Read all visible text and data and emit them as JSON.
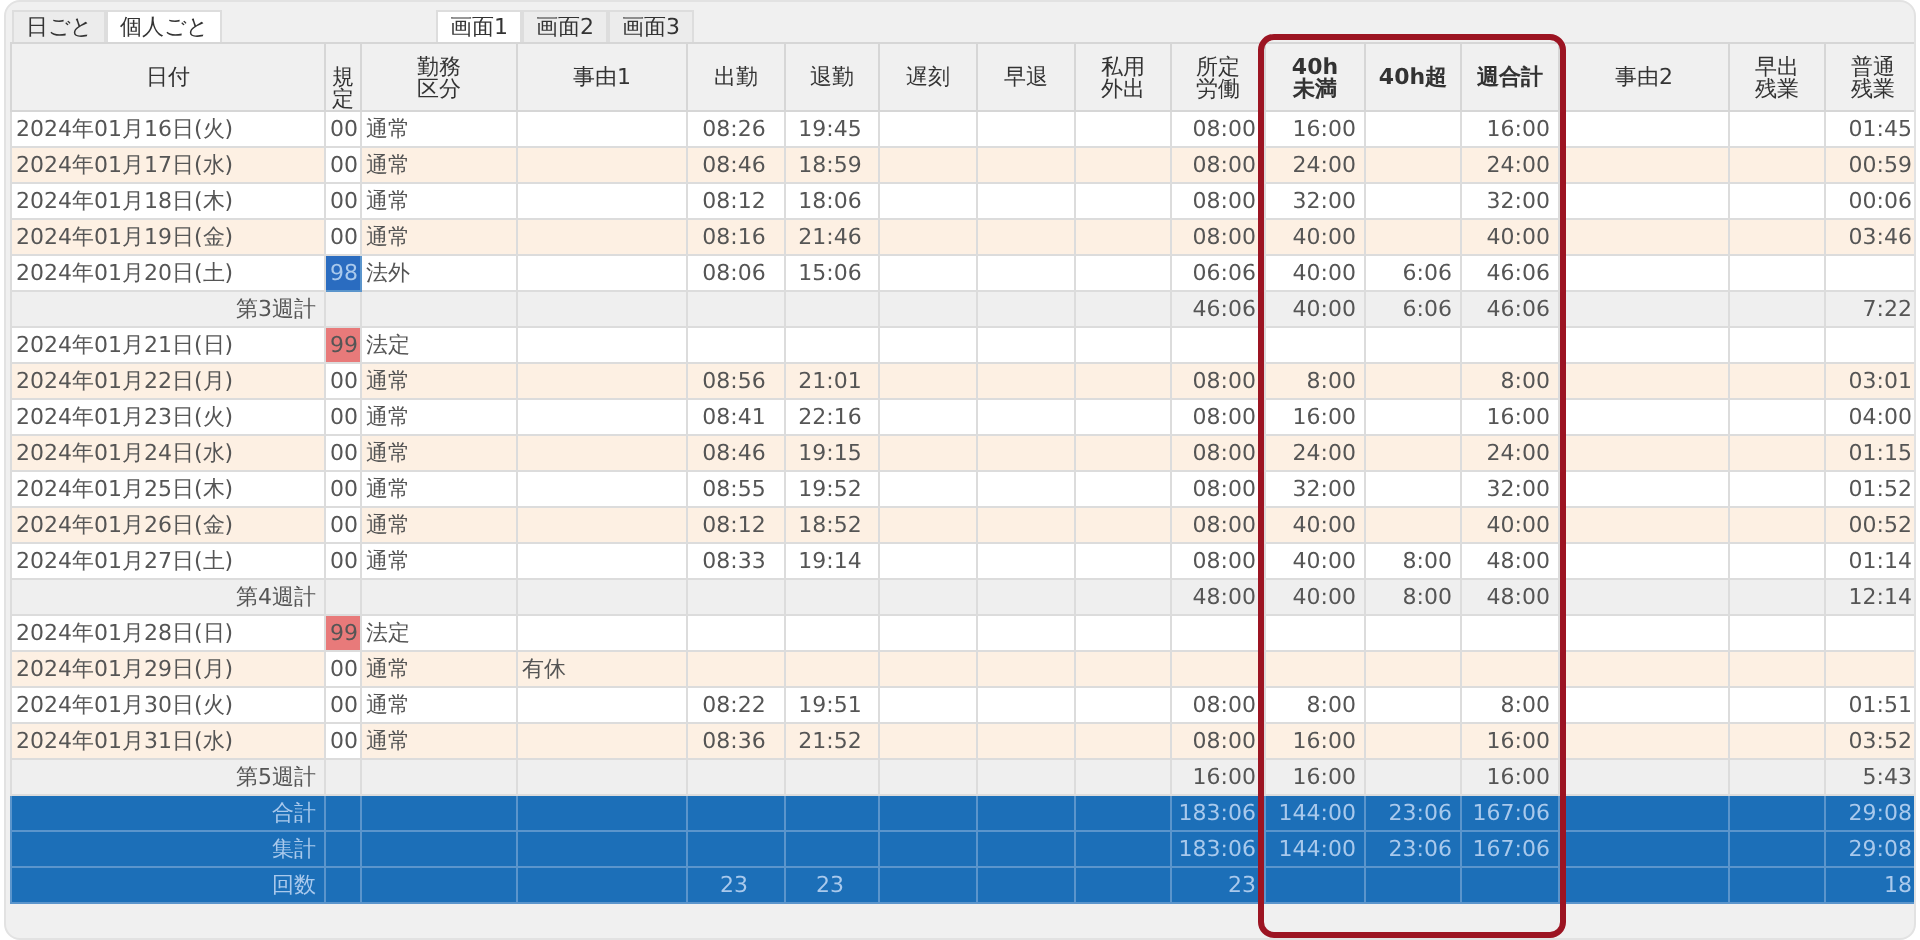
{
  "view_tabs": [
    {
      "label": "日ごと",
      "selected": false
    },
    {
      "label": "個人ごと",
      "selected": true
    }
  ],
  "screen_tabs": [
    {
      "label": "画面1",
      "selected": true
    },
    {
      "label": "画面2",
      "selected": false
    },
    {
      "label": "画面3",
      "selected": false
    }
  ],
  "columns": [
    {
      "label": "日付",
      "wrap": false,
      "highlight": false
    },
    {
      "label": "規定",
      "wrap": true,
      "highlight": false
    },
    {
      "label": "勤務区分",
      "wrap": true,
      "highlight": false
    },
    {
      "label": "事由1",
      "wrap": false,
      "highlight": false
    },
    {
      "label": "出勤",
      "wrap": false,
      "highlight": false
    },
    {
      "label": "退勤",
      "wrap": false,
      "highlight": false
    },
    {
      "label": "遅刻",
      "wrap": false,
      "highlight": false
    },
    {
      "label": "早退",
      "wrap": false,
      "highlight": false
    },
    {
      "label": "私用外出",
      "wrap": true,
      "highlight": false
    },
    {
      "label": "所定労働",
      "wrap": true,
      "highlight": false
    },
    {
      "label": "40h未満",
      "wrap": true,
      "highlight": true
    },
    {
      "label": "40h超",
      "wrap": false,
      "highlight": true
    },
    {
      "label": "週合計",
      "wrap": false,
      "highlight": true
    },
    {
      "label": "事由2",
      "wrap": false,
      "highlight": false
    },
    {
      "label": "早出残業",
      "wrap": true,
      "highlight": false
    },
    {
      "label": "普通残業",
      "wrap": true,
      "highlight": false
    }
  ],
  "rows": [
    {
      "kind": "day",
      "shaded": false,
      "date": "2024年01月16日(火)",
      "code": {
        "text": "00",
        "color": "#ffffff"
      },
      "category": "通常",
      "clock_in": "08:26",
      "clock_out": "19:45",
      "scheduled": "08:00",
      "under_40h": "16:00",
      "week_total": "16:00",
      "normal_overtime": "01:45"
    },
    {
      "kind": "day",
      "shaded": true,
      "date": "2024年01月17日(水)",
      "code": {
        "text": "00",
        "color": "#ffffff"
      },
      "category": "通常",
      "clock_in": "08:46",
      "clock_out": "18:59",
      "scheduled": "08:00",
      "under_40h": "24:00",
      "week_total": "24:00",
      "normal_overtime": "00:59"
    },
    {
      "kind": "day",
      "shaded": false,
      "date": "2024年01月18日(木)",
      "code": {
        "text": "00",
        "color": "#ffffff"
      },
      "category": "通常",
      "clock_in": "08:12",
      "clock_out": "18:06",
      "scheduled": "08:00",
      "under_40h": "32:00",
      "week_total": "32:00",
      "normal_overtime": "00:06"
    },
    {
      "kind": "day",
      "shaded": true,
      "date": "2024年01月19日(金)",
      "code": {
        "text": "00",
        "color": "#ffffff"
      },
      "category": "通常",
      "clock_in": "08:16",
      "clock_out": "21:46",
      "scheduled": "08:00",
      "under_40h": "40:00",
      "week_total": "40:00",
      "normal_overtime": "03:46"
    },
    {
      "kind": "day",
      "shaded": false,
      "date": "2024年01月20日(土)",
      "code": {
        "text": "98",
        "color": "#2a6cc0"
      },
      "category": "法外",
      "clock_in": "08:06",
      "clock_out": "15:06",
      "scheduled": "06:06",
      "under_40h": "40:00",
      "over_40h": "6:06",
      "week_total": "46:06"
    },
    {
      "kind": "week",
      "date": "第3週計",
      "scheduled": "46:06",
      "under_40h": "40:00",
      "over_40h": "6:06",
      "week_total": "46:06",
      "normal_overtime": "7:22"
    },
    {
      "kind": "day",
      "shaded": false,
      "date": "2024年01月21日(日)",
      "code": {
        "text": "99",
        "color": "#e87a7a"
      },
      "category": "法定"
    },
    {
      "kind": "day",
      "shaded": true,
      "date": "2024年01月22日(月)",
      "code": {
        "text": "00",
        "color": "#ffffff"
      },
      "category": "通常",
      "clock_in": "08:56",
      "clock_out": "21:01",
      "scheduled": "08:00",
      "under_40h": "8:00",
      "week_total": "8:00",
      "normal_overtime": "03:01"
    },
    {
      "kind": "day",
      "shaded": false,
      "date": "2024年01月23日(火)",
      "code": {
        "text": "00",
        "color": "#ffffff"
      },
      "category": "通常",
      "clock_in": "08:41",
      "clock_out": "22:16",
      "scheduled": "08:00",
      "under_40h": "16:00",
      "week_total": "16:00",
      "normal_overtime": "04:00"
    },
    {
      "kind": "day",
      "shaded": true,
      "date": "2024年01月24日(水)",
      "code": {
        "text": "00",
        "color": "#ffffff"
      },
      "category": "通常",
      "clock_in": "08:46",
      "clock_out": "19:15",
      "scheduled": "08:00",
      "under_40h": "24:00",
      "week_total": "24:00",
      "normal_overtime": "01:15"
    },
    {
      "kind": "day",
      "shaded": false,
      "date": "2024年01月25日(木)",
      "code": {
        "text": "00",
        "color": "#ffffff"
      },
      "category": "通常",
      "clock_in": "08:55",
      "clock_out": "19:52",
      "scheduled": "08:00",
      "under_40h": "32:00",
      "week_total": "32:00",
      "normal_overtime": "01:52"
    },
    {
      "kind": "day",
      "shaded": true,
      "date": "2024年01月26日(金)",
      "code": {
        "text": "00",
        "color": "#ffffff"
      },
      "category": "通常",
      "clock_in": "08:12",
      "clock_out": "18:52",
      "scheduled": "08:00",
      "under_40h": "40:00",
      "week_total": "40:00",
      "normal_overtime": "00:52"
    },
    {
      "kind": "day",
      "shaded": false,
      "date": "2024年01月27日(土)",
      "code": {
        "text": "00",
        "color": "#ffffff"
      },
      "category": "通常",
      "clock_in": "08:33",
      "clock_out": "19:14",
      "scheduled": "08:00",
      "under_40h": "40:00",
      "over_40h": "8:00",
      "week_total": "48:00",
      "normal_overtime": "01:14"
    },
    {
      "kind": "week",
      "date": "第4週計",
      "scheduled": "48:00",
      "under_40h": "40:00",
      "over_40h": "8:00",
      "week_total": "48:00",
      "normal_overtime": "12:14"
    },
    {
      "kind": "day",
      "shaded": false,
      "date": "2024年01月28日(日)",
      "code": {
        "text": "99",
        "color": "#e87a7a"
      },
      "category": "法定"
    },
    {
      "kind": "day",
      "shaded": true,
      "date": "2024年01月29日(月)",
      "code": {
        "text": "00",
        "color": "#ffffff"
      },
      "category": "通常",
      "reason1": "有休"
    },
    {
      "kind": "day",
      "shaded": false,
      "date": "2024年01月30日(火)",
      "code": {
        "text": "00",
        "color": "#ffffff"
      },
      "category": "通常",
      "clock_in": "08:22",
      "clock_out": "19:51",
      "scheduled": "08:00",
      "under_40h": "8:00",
      "week_total": "8:00",
      "normal_overtime": "01:51"
    },
    {
      "kind": "day",
      "shaded": true,
      "date": "2024年01月31日(水)",
      "code": {
        "text": "00",
        "color": "#ffffff"
      },
      "category": "通常",
      "clock_in": "08:36",
      "clock_out": "21:52",
      "scheduled": "08:00",
      "under_40h": "16:00",
      "week_total": "16:00",
      "normal_overtime": "03:52"
    },
    {
      "kind": "week",
      "date": "第5週計",
      "scheduled": "16:00",
      "under_40h": "16:00",
      "week_total": "16:00",
      "normal_overtime": "5:43"
    },
    {
      "kind": "total",
      "date": "合計",
      "scheduled": "183:06",
      "under_40h": "144:00",
      "over_40h": "23:06",
      "week_total": "167:06",
      "normal_overtime": "29:08"
    },
    {
      "kind": "total",
      "date": "集計",
      "scheduled": "183:06",
      "under_40h": "144:00",
      "over_40h": "23:06",
      "week_total": "167:06",
      "normal_overtime": "29:08"
    },
    {
      "kind": "total",
      "date": "回数",
      "clock_in": "23",
      "clock_out": "23",
      "scheduled": "23",
      "normal_overtime": "18"
    }
  ]
}
